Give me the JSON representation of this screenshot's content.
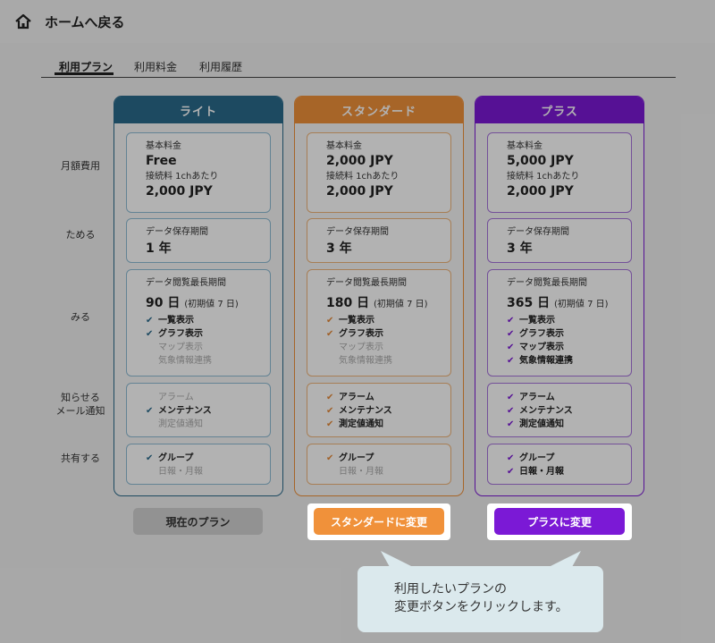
{
  "header": {
    "home_label": "ホームへ戻る"
  },
  "tabs": [
    {
      "label": "利用プラン",
      "active": true
    },
    {
      "label": "利用料金",
      "active": false
    },
    {
      "label": "利用履歴",
      "active": false
    }
  ],
  "row_labels": {
    "monthly": "月額費用",
    "store": "ためる",
    "view": "みる",
    "notify_1": "知らせる",
    "notify_2": "メール通知",
    "share": "共有する"
  },
  "plans": [
    {
      "name": "ライト",
      "color": "#2a6a8c",
      "check_color": "#2a6a8c",
      "box_border": "#8fbcd4",
      "base_fee_label": "基本料金",
      "base_fee": "Free",
      "conn_fee_label": "接続料 1chあたり",
      "conn_fee": "2,000 JPY",
      "storage_label": "データ保存期間",
      "storage": "1 年",
      "view_label": "データ閲覧最長期間",
      "view_days": "90 日",
      "view_initial": "(初期値 7 日)",
      "view_features": [
        {
          "label": "一覧表示",
          "enabled": true
        },
        {
          "label": "グラフ表示",
          "enabled": true
        },
        {
          "label": "マップ表示",
          "enabled": false
        },
        {
          "label": "気象情報連携",
          "enabled": false
        }
      ],
      "notify_features": [
        {
          "label": "アラーム",
          "enabled": false
        },
        {
          "label": "メンテナンス",
          "enabled": true
        },
        {
          "label": "測定値通知",
          "enabled": false
        }
      ],
      "share_features": [
        {
          "label": "グループ",
          "enabled": true
        },
        {
          "label": "日報・月報",
          "enabled": false
        }
      ],
      "button_label": "現在のプラン"
    },
    {
      "name": "スタンダード",
      "color": "#f0913a",
      "check_color": "#e58a3a",
      "box_border": "#f0b57a",
      "base_fee_label": "基本料金",
      "base_fee": "2,000 JPY",
      "conn_fee_label": "接続料 1chあたり",
      "conn_fee": "2,000 JPY",
      "storage_label": "データ保存期間",
      "storage": "3 年",
      "view_label": "データ閲覧最長期間",
      "view_days": "180 日",
      "view_initial": "(初期値 7 日)",
      "view_features": [
        {
          "label": "一覧表示",
          "enabled": true
        },
        {
          "label": "グラフ表示",
          "enabled": true
        },
        {
          "label": "マップ表示",
          "enabled": false
        },
        {
          "label": "気象情報連携",
          "enabled": false
        }
      ],
      "notify_features": [
        {
          "label": "アラーム",
          "enabled": true
        },
        {
          "label": "メンテナンス",
          "enabled": true
        },
        {
          "label": "測定値通知",
          "enabled": true
        }
      ],
      "share_features": [
        {
          "label": "グループ",
          "enabled": true
        },
        {
          "label": "日報・月報",
          "enabled": false
        }
      ],
      "button_label": "スタンダードに変更"
    },
    {
      "name": "プラス",
      "color": "#7b19d6",
      "check_color": "#7b19d6",
      "box_border": "#a773dc",
      "base_fee_label": "基本料金",
      "base_fee": "5,000 JPY",
      "conn_fee_label": "接続料 1chあたり",
      "conn_fee": "2,000 JPY",
      "storage_label": "データ保存期間",
      "storage": "3 年",
      "view_label": "データ閲覧最長期間",
      "view_days": "365 日",
      "view_initial": "(初期値 7 日)",
      "view_features": [
        {
          "label": "一覧表示",
          "enabled": true
        },
        {
          "label": "グラフ表示",
          "enabled": true
        },
        {
          "label": "マップ表示",
          "enabled": true
        },
        {
          "label": "気象情報連携",
          "enabled": true
        }
      ],
      "notify_features": [
        {
          "label": "アラーム",
          "enabled": true
        },
        {
          "label": "メンテナンス",
          "enabled": true
        },
        {
          "label": "測定値通知",
          "enabled": true
        }
      ],
      "share_features": [
        {
          "label": "グループ",
          "enabled": true
        },
        {
          "label": "日報・月報",
          "enabled": true
        }
      ],
      "button_label": "プラスに変更"
    }
  ],
  "callout": {
    "line1": "利用したいプランの",
    "line2": "変更ボタンをクリックします。"
  },
  "check_glyph": "✔",
  "icons": {
    "home": "home-icon"
  }
}
